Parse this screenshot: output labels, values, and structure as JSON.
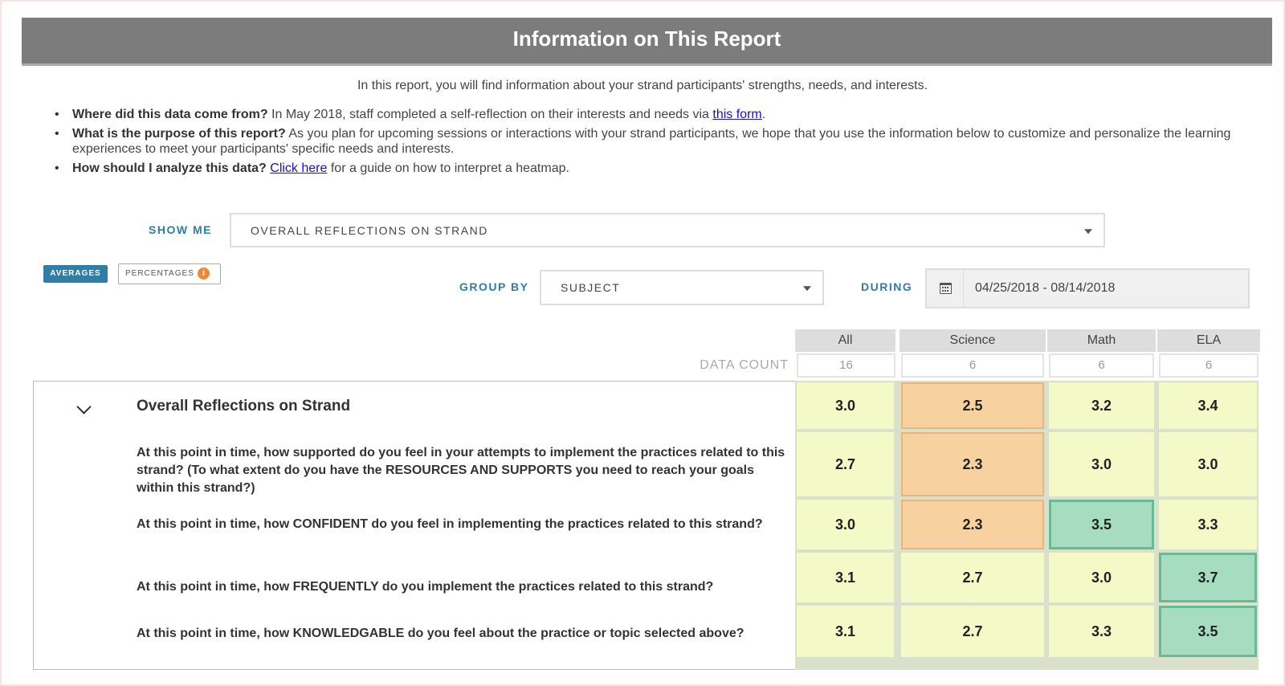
{
  "banner": {
    "title": "Information on This Report"
  },
  "intro": "In this report, you will find information about your strand participants' strengths, needs, and interests.",
  "bullets": [
    {
      "q": "Where did this data come from?",
      "pre": " In May 2018, staff completed a self-reflection on their interests and needs via ",
      "link": "this form",
      "post": "."
    },
    {
      "q": "What is the purpose of this report?",
      "pre": " As you plan for upcoming sessions or interactions with your strand participants, we hope that you use the information below to customize and personalize the learning experiences to meet your participants' specific needs and interests.",
      "link": "",
      "post": ""
    },
    {
      "q": "How should I analyze this data?",
      "pre": " ",
      "link": "Click here",
      "post": " for a guide on how to interpret a heatmap."
    }
  ],
  "controls": {
    "show_me_label": "SHOW ME",
    "show_me_value": "OVERALL REFLECTIONS ON STRAND",
    "averages_label": "AVERAGES",
    "percentages_label": "PERCENTAGES",
    "info_glyph": "i",
    "group_by_label": "GROUP BY",
    "group_by_value": "SUBJECT",
    "during_label": "DURING",
    "date_range": "04/25/2018 - 08/14/2018"
  },
  "colors": {
    "accent": "#2e7ea8",
    "banner": "#7c7c7c",
    "low": "#f7d2a0",
    "mid": "#f4f9c8",
    "high": "#a6dcc0"
  },
  "table": {
    "data_count_label": "DATA COUNT",
    "columns": [
      {
        "name": "All",
        "count": "16"
      },
      {
        "name": "Science",
        "count": "6"
      },
      {
        "name": "Math",
        "count": "6"
      },
      {
        "name": "ELA",
        "count": "6"
      }
    ],
    "group_title": "Overall Reflections on Strand",
    "rows": [
      {
        "label": "Overall Reflections on Strand",
        "values": [
          "3.0",
          "2.5",
          "3.2",
          "3.4"
        ],
        "levels": [
          "mid",
          "low",
          "mid",
          "mid"
        ]
      },
      {
        "label": "At this point in time, how supported do you feel in your attempts to implement the practices related to this strand? (To what extent do you have the RESOURCES AND SUPPORTS you need to reach your goals within this strand?)",
        "values": [
          "2.7",
          "2.3",
          "3.0",
          "3.0"
        ],
        "levels": [
          "mid",
          "low",
          "mid",
          "mid"
        ]
      },
      {
        "label": "At this point in time, how CONFIDENT do you feel in implementing the practices related to this strand?",
        "values": [
          "3.0",
          "2.3",
          "3.5",
          "3.3"
        ],
        "levels": [
          "mid",
          "low",
          "high",
          "mid"
        ]
      },
      {
        "label": "At this point in time, how FREQUENTLY do you implement the practices related to this strand?",
        "values": [
          "3.1",
          "2.7",
          "3.0",
          "3.7"
        ],
        "levels": [
          "mid",
          "mid",
          "mid",
          "high"
        ]
      },
      {
        "label": "At this point in time, how KNOWLEDGABLE do you feel about the practice or topic selected above?",
        "values": [
          "3.1",
          "2.7",
          "3.3",
          "3.5"
        ],
        "levels": [
          "mid",
          "mid",
          "mid",
          "high"
        ]
      }
    ]
  }
}
